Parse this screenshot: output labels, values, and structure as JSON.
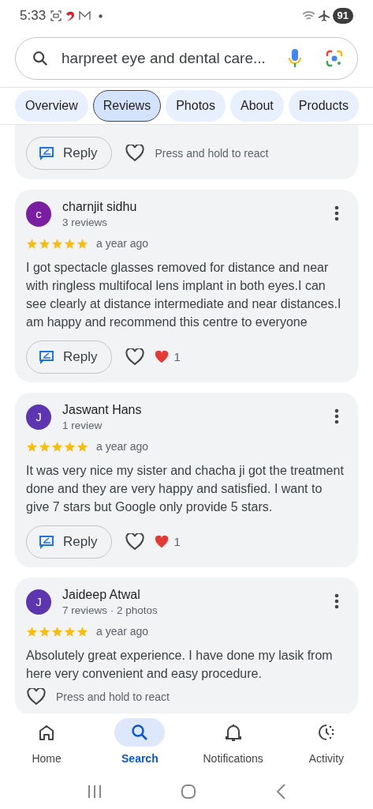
{
  "status_bar": {
    "time": "5:33",
    "battery": "91"
  },
  "search": {
    "value": "harpreet eye and dental care..."
  },
  "tabs": [
    {
      "label": "Overview",
      "selected": false
    },
    {
      "label": "Reviews",
      "selected": true
    },
    {
      "label": "Photos",
      "selected": false
    },
    {
      "label": "About",
      "selected": false
    },
    {
      "label": "Products",
      "selected": false
    }
  ],
  "reviews": [
    {
      "partial": true,
      "reply_button": "Reply",
      "liked": false,
      "react_hint": "Press and hold to react"
    },
    {
      "avatar": "c",
      "color": "#7b1fa2",
      "name": "charnjit sidhu",
      "meta": "3 reviews",
      "stars": 5,
      "time": "a year ago",
      "text": "I got spectacle glasses removed for distance and near with ringless multifocal lens implant in both eyes.I can see clearly at distance intermediate and near distances.I am happy and recommend this centre to everyone",
      "reply_button": "Reply",
      "liked": false,
      "reaction_count": "1"
    },
    {
      "avatar": "J",
      "color": "#5e35b1",
      "name": "Jaswant Hans",
      "meta": "1 review",
      "stars": 5,
      "time": "a year ago",
      "text": "It was very nice my sister and chacha ji got the treatment done and they are very happy and satisfied. I want to give 7 stars but Google only provide 5 stars.",
      "reply_button": "Reply",
      "liked": false,
      "reaction_count": "1"
    },
    {
      "avatar": "J",
      "color": "#5e35b1",
      "name": "Jaideep Atwal",
      "meta": "7 reviews · 2 photos",
      "stars": 5,
      "time": "a year ago",
      "text": "Absolutely great experience. I have done my lasik from here very convenient and easy procedure.",
      "liked": false,
      "react_hint": "Press and hold to react"
    }
  ],
  "bottom_nav": [
    {
      "label": "Home",
      "selected": false
    },
    {
      "label": "Search",
      "selected": true
    },
    {
      "label": "Notifications",
      "selected": false
    },
    {
      "label": "Activity",
      "selected": false
    }
  ]
}
